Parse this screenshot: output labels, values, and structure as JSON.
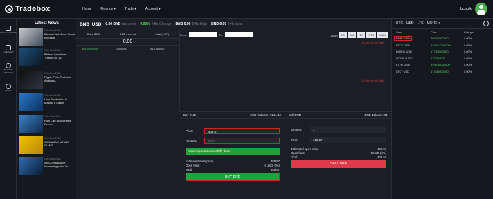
{
  "brand": {
    "name": "Tradebox"
  },
  "nav": [
    {
      "label": "Home"
    },
    {
      "label": "Finance ▾"
    },
    {
      "label": "Trade ▾"
    },
    {
      "label": "Account ▾"
    }
  ],
  "user": {
    "name": "bctask"
  },
  "sidebar": [
    {
      "label": "BACK TO HOME",
      "icon": "home-icon"
    },
    {
      "label": "LIVE CHAT",
      "icon": "chat-icon"
    },
    {
      "label": "TRADING HISTORY",
      "icon": "history-icon"
    },
    {
      "label": "NEWS",
      "icon": "globe-icon"
    }
  ],
  "news": {
    "title": "Latest News",
    "items": [
      {
        "date": "19th June 2018",
        "headline": "Bitcoin Cash Price Trend Including"
      },
      {
        "date": "19th June 2018",
        "headline": "Bitfinex Introduces Trading for 12"
      },
      {
        "date": "19th June 2018",
        "headline": "Ripple Price Technical Analysis -"
      },
      {
        "date": "19th June 2018",
        "headline": "How Blockchain Is Making It Easier"
      },
      {
        "date": "19th June 2018",
        "headline": "How Can Blockchains Remo..."
      },
      {
        "date": "19th June 2018",
        "headline": "CANADIAN MINING GIANT ..."
      },
      {
        "date": "19th June 2018",
        "headline": "ASIC Resistance Increasingly Hot To"
      }
    ]
  },
  "ticker": {
    "symbol": "BNB_USD",
    "last_price_value": "0.00 BNB",
    "last_price_label": "last price",
    "change_value": "0.00%",
    "change_label": "24hr Change",
    "high_value": "BNB 0.00",
    "high_label": "24hr High",
    "low_value": "BNB 0.00",
    "low_label": "24hr Low"
  },
  "orderbook": {
    "headers": [
      "Price BNB",
      "BNB Amount",
      "Total (USD)"
    ],
    "mid_price": "0.00",
    "rows": [
      {
        "price": "409.29000000",
        "amount": "2.000000",
        "total": "818.580000"
      }
    ]
  },
  "chart": {
    "from_label": "From:",
    "to_label": "To:",
    "zoom_label": "Zoom",
    "zoom_buttons": [
      "1D",
      "1M",
      "1Y",
      "YTD",
      "MAX"
    ],
    "note": "JS chart by amCharts"
  },
  "buy": {
    "title": "Buy BNB",
    "balance": "USD Balance: 9181.42",
    "price_label": "Price:",
    "price_value": "409.57",
    "amount_label": "Amount:",
    "amount_placeholder": "BNB",
    "alert": "Your request successfully done",
    "est_label": "Estimated open price:",
    "est_value": "409.57",
    "fees_label": "Open fees:",
    "fees_value": "0 USD (0%)",
    "total_label": "Total",
    "total_value": "409.57",
    "button": "BUY BNB"
  },
  "sell": {
    "title": "Sell BNB",
    "balance": "BNB Balance: 51",
    "amount_label": "Amount:",
    "amount_value": "1",
    "price_label": "Price:",
    "price_value": "409.57",
    "est_label": "Estimated open price:",
    "est_value": "409.57",
    "fees_label": "Open fees:",
    "fees_value": "0 USD (0%)",
    "total_label": "Total:",
    "total_value": "409.57",
    "button": "SELL BNB"
  },
  "markets": {
    "tabs": [
      "BTC",
      "USD",
      "LTC",
      "MORE ▾"
    ],
    "active_tab": "USD",
    "headers": [
      "Coin",
      "Price",
      "Change"
    ],
    "rows": [
      {
        "coin": "BNB / USD",
        "price": "200.00000000",
        "change": "0.00%"
      },
      {
        "coin": "BTC / USD",
        "price": "57000.52000000",
        "change": "0.00%"
      },
      {
        "coin": "DASH / USD",
        "price": "177.60000000",
        "change": "0.00%"
      },
      {
        "coin": "DOGE / USD",
        "price": "0.22020000",
        "change": "0.00%"
      },
      {
        "coin": "ETH / USD",
        "price": "3490.48000000",
        "change": "0.00%"
      },
      {
        "coin": "LTC / USD",
        "price": "174.35000000",
        "change": "0.00%"
      }
    ]
  },
  "colors": {
    "up": "#5bd16b",
    "down": "#e0394a",
    "accent": "#1fa23b"
  }
}
